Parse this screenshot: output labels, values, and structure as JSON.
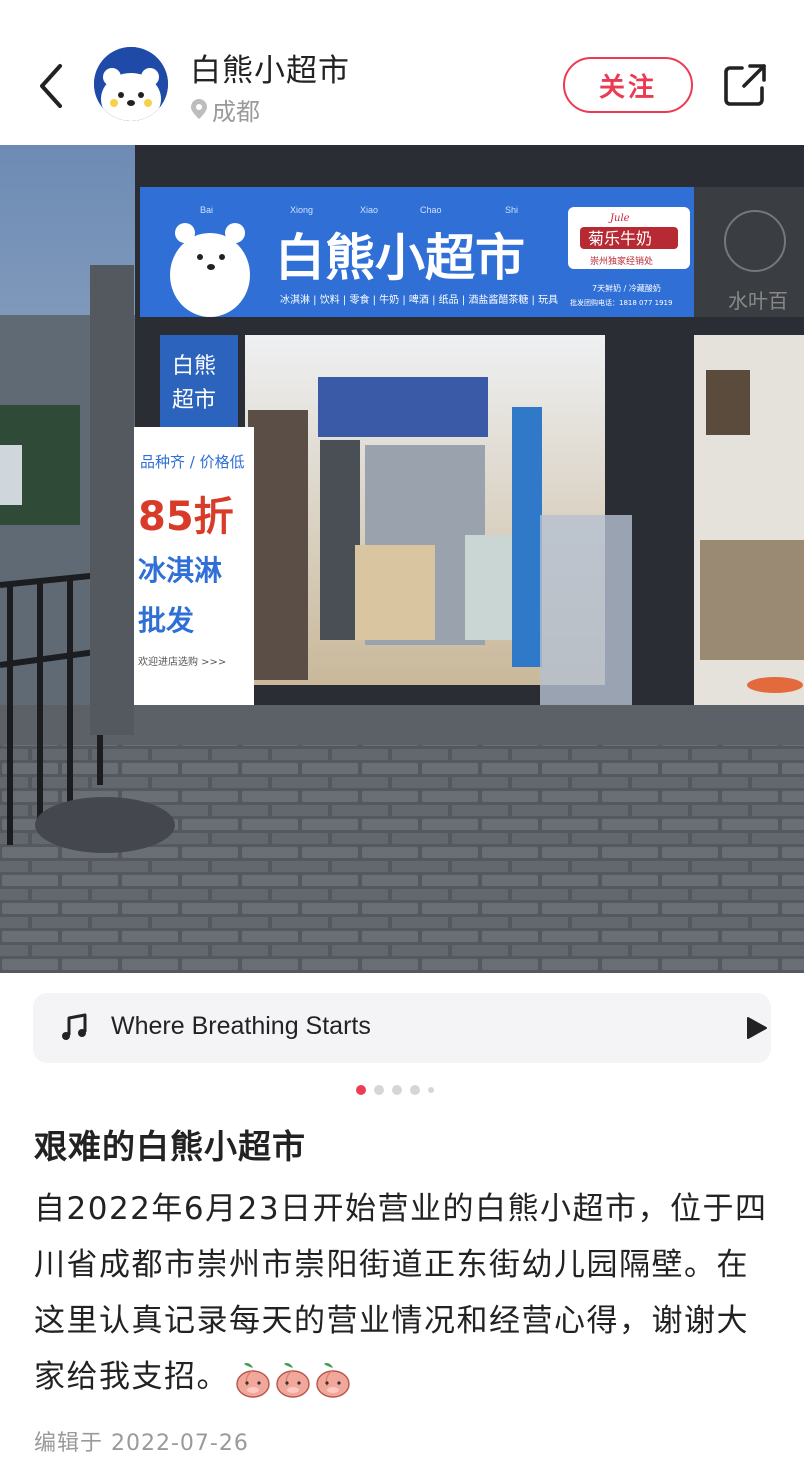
{
  "header": {
    "author_name": "白熊小超市",
    "location": "成都",
    "follow_label": "关注"
  },
  "photo": {
    "sign_title": "白熊小超市",
    "sign_pinyin": [
      "Bai",
      "Xiong",
      "Xiao",
      "Chao",
      "Shi"
    ],
    "sign_items": "冰淇淋 | 饮料 | 零食 | 牛奶 | 啤酒 | 纸品 | 酒盐酱醋茶糖 | 玩具",
    "milk_brand_en": "Jule",
    "milk_brand": "菊乐牛奶",
    "milk_dealer": "崇州独家经销处",
    "milk_fresh": "7天鲜奶 / 冷藏酸奶",
    "milk_phone": "批发团购电话：1818 077 1919",
    "side_sign": [
      "白熊",
      "超市"
    ],
    "banner_line1": "品种齐 / 价格低",
    "banner_discount": "85折",
    "banner_line2": "冰淇淋",
    "banner_line3": "批发",
    "banner_footer": "欢迎进店选购 >>>",
    "neighbor_sign": "水叶百"
  },
  "music": {
    "title": "Where Breathing Starts"
  },
  "pager": {
    "active_index": 0,
    "count": 5
  },
  "post": {
    "title": "艰难的白熊小超市",
    "body": "自2022年6月23日开始营业的白熊小超市，位于四川省成都市崇州市崇阳街道正东街幼儿园隔壁。在这里认真记录每天的营业情况和经营心得，谢谢大家给我支招。",
    "edited": "编辑于 2022-07-26"
  },
  "colors": {
    "accent": "#ec3a52",
    "sign_blue": "#2f6fd6",
    "avatar_blue": "#1f4aa8"
  },
  "icons": [
    "back-icon",
    "location-icon",
    "share-icon",
    "music-note-icon",
    "play-icon",
    "peach-emoji"
  ]
}
